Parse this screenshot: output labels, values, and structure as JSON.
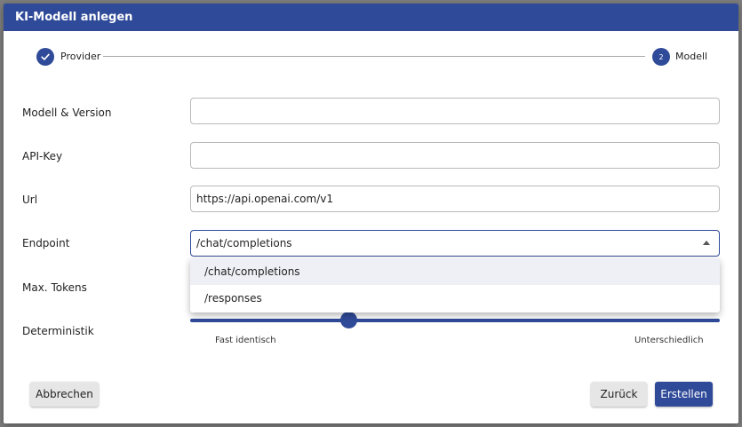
{
  "dialog": {
    "title": "KI-Modell anlegen"
  },
  "stepper": {
    "steps": [
      {
        "label": "Provider",
        "state": "completed",
        "icon": "check-icon"
      },
      {
        "label": "Modell",
        "number": "2",
        "state": "active"
      }
    ]
  },
  "form": {
    "model_label": "Modell & Version",
    "model_value": "",
    "apikey_label": "API-Key",
    "apikey_value": "",
    "url_label": "Url",
    "url_value": "https://api.openai.com/v1",
    "endpoint_label": "Endpoint",
    "endpoint_value": "/chat/completions",
    "maxtokens_label": "Max. Tokens",
    "deterministic_label": "Deterministik",
    "deterministic_min_label": "Fast identisch",
    "deterministic_max_label": "Unterschiedlich",
    "deterministic_level": 0.3
  },
  "dropdown": {
    "options": [
      "/chat/completions",
      "/responses"
    ],
    "selected": "/chat/completions"
  },
  "buttons": {
    "cancel": "Abbrechen",
    "back": "Zurück",
    "create": "Erstellen"
  },
  "colors": {
    "primary": "#2f4a98",
    "overlay": "#7d7d7d"
  }
}
